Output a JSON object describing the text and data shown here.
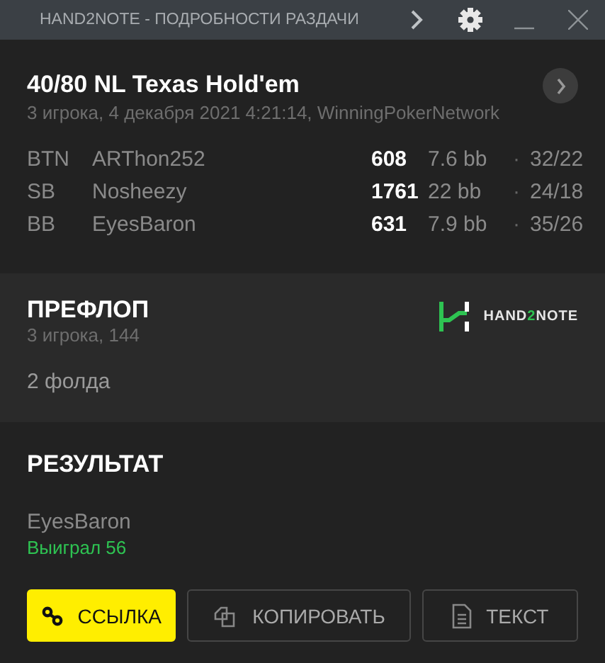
{
  "window": {
    "title": "HAND2NOTE - ПОДРОБНОСТИ РАЗДАЧИ"
  },
  "hand": {
    "title": "40/80 NL Texas Hold'em",
    "subtitle": "3 игрока, 4 декабря 2021 4:21:14, WinningPokerNetwork",
    "players": [
      {
        "position": "BTN",
        "name": "ARThon252",
        "stack": "608",
        "bb": "7.6 bb",
        "sep": "·",
        "stats": "32/22"
      },
      {
        "position": "SB",
        "name": "Nosheezy",
        "stack": "1761",
        "bb": "22 bb",
        "sep": "·",
        "stats": "24/18"
      },
      {
        "position": "BB",
        "name": "EyesBaron",
        "stack": "631",
        "bb": "7.9 bb",
        "sep": "·",
        "stats": "35/26"
      }
    ]
  },
  "preflop": {
    "title": "ПРЕФЛОП",
    "subtitle": "3 игрока, 144",
    "action": "2 фолда",
    "logo": [
      {
        "text": "HAND",
        "accent": false
      },
      {
        "text": "2",
        "accent": true
      },
      {
        "text": "NOTE",
        "accent": false
      }
    ]
  },
  "result": {
    "title": "РЕЗУЛЬТАТ",
    "player": "EyesBaron",
    "outcome": "Выиграл 56"
  },
  "buttons": [
    {
      "kind": "link",
      "label": "ССЫЛКА",
      "primary": true
    },
    {
      "kind": "copy",
      "label": "КОПИРОВАТЬ",
      "primary": false
    },
    {
      "kind": "text",
      "label": "ТЕКСТ",
      "primary": false
    }
  ]
}
